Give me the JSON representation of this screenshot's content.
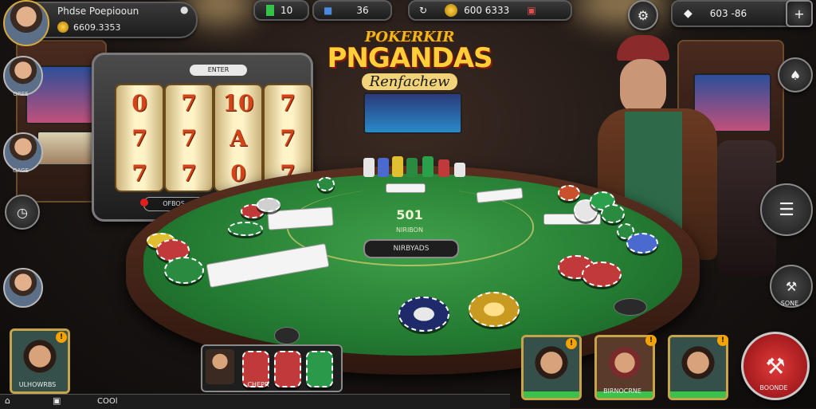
{
  "header": {
    "username": "Phdse Poepiooun",
    "balance": "6609.3353",
    "stat_a": "10",
    "stat_b": "36",
    "coins": "600 6333",
    "side_readout": "603 -86"
  },
  "title": {
    "line1": "POKERKIR",
    "line2": "PNGANDAS",
    "line3": "Renfachew"
  },
  "left_players": [
    {
      "label": "OREE"
    },
    {
      "label": "GAGE"
    }
  ],
  "slot": {
    "top_label": "ENTER",
    "bottom_label": "OFBOS",
    "reels": [
      [
        "0",
        "7",
        "7"
      ],
      [
        "7",
        "7",
        "7"
      ],
      [
        "10",
        "A",
        "0"
      ],
      [
        "7",
        "7",
        "7"
      ]
    ]
  },
  "table": {
    "pot_amount": "501",
    "pot_label": "NIRIBON",
    "center_button": "NIRBYADS"
  },
  "hand_tray": {
    "label": "CHEPR"
  },
  "bottom": {
    "self_label": "ULHOWRBS",
    "hint": "COOl",
    "players": [
      {
        "label": ""
      },
      {
        "label": "BIRNOCRNE"
      },
      {
        "label": ""
      }
    ],
    "action_label": "BOONDE",
    "right_btn_label": "SONE"
  },
  "icons": {
    "settings": "gear-icon",
    "chat": "chat-icon",
    "add": "plus-icon"
  },
  "colors": {
    "felt": "#237a31",
    "rail": "#5a3020",
    "accent": "#f5a300",
    "action": "#b8181d"
  }
}
